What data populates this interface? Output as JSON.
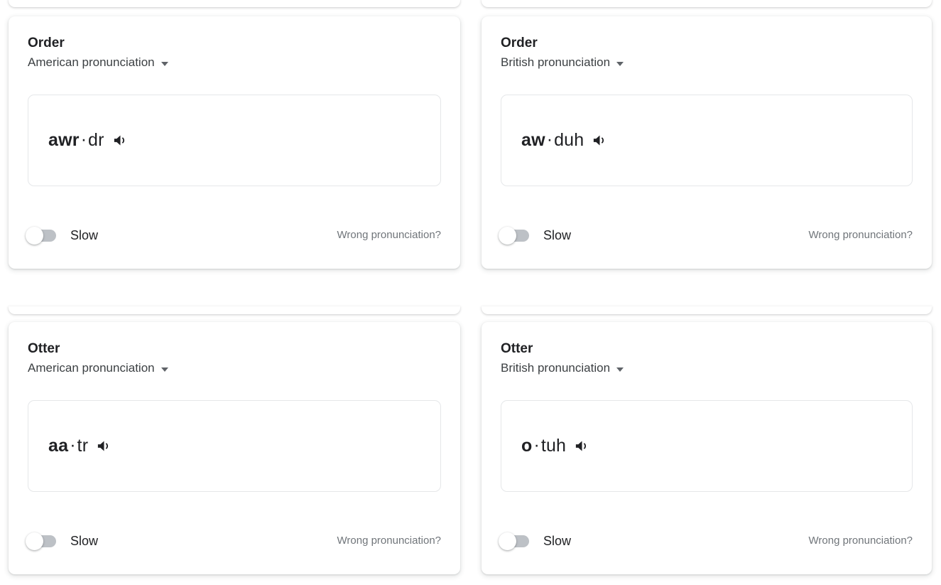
{
  "layout": {
    "background": "#ffffff",
    "card_border_radius": 9,
    "accent_text": "#202124",
    "muted_text": "#70757a",
    "toggle_track_color": "#bdc1c6"
  },
  "cards": [
    {
      "word": "Order",
      "dialect": "American pronunciation",
      "phonetic_stress": "awr",
      "phonetic_separator": "·",
      "phonetic_rest": "dr",
      "phonetic_full": "awr·dr",
      "speaker_icon": "speaker-icon",
      "dropdown_icon": "chevron-down-icon",
      "slow_label": "Slow",
      "slow_enabled": false,
      "wrong_link": "Wrong pronunciation?"
    },
    {
      "word": "Order",
      "dialect": "British pronunciation",
      "phonetic_stress": "aw",
      "phonetic_separator": "·",
      "phonetic_rest": "duh",
      "phonetic_full": "aw·duh",
      "speaker_icon": "speaker-icon",
      "dropdown_icon": "chevron-down-icon",
      "slow_label": "Slow",
      "slow_enabled": false,
      "wrong_link": "Wrong pronunciation?"
    },
    {
      "word": "Otter",
      "dialect": "American pronunciation",
      "phonetic_stress": "aa",
      "phonetic_separator": "·",
      "phonetic_rest": "tr",
      "phonetic_full": "aa·tr",
      "speaker_icon": "speaker-icon",
      "dropdown_icon": "chevron-down-icon",
      "slow_label": "Slow",
      "slow_enabled": false,
      "wrong_link": "Wrong pronunciation?"
    },
    {
      "word": "Otter",
      "dialect": "British pronunciation",
      "phonetic_stress": "o",
      "phonetic_separator": "·",
      "phonetic_rest": "tuh",
      "phonetic_full": "o·tuh",
      "speaker_icon": "speaker-icon",
      "dropdown_icon": "chevron-down-icon",
      "slow_label": "Slow",
      "slow_enabled": false,
      "wrong_link": "Wrong pronunciation?"
    }
  ]
}
